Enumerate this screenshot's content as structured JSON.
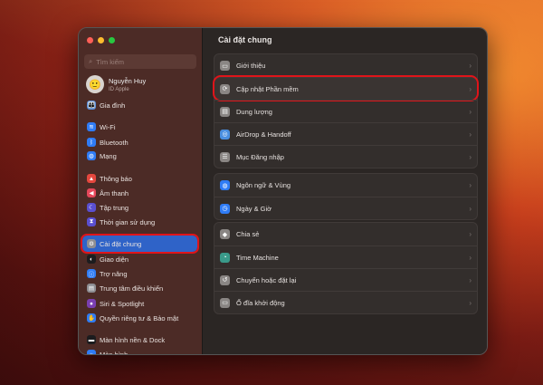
{
  "sidebar": {
    "search_placeholder": "Tìm kiếm",
    "profile": {
      "name": "Nguyễn Huy",
      "subtitle": "ID Apple"
    },
    "items": [
      {
        "label": "Gia đình",
        "icon": "family-icon",
        "color": "#5b8fd9"
      },
      {
        "label": "Wi-Fi",
        "icon": "wifi-icon",
        "color": "#2f7cf6"
      },
      {
        "label": "Bluetooth",
        "icon": "bluetooth-icon",
        "color": "#2f7cf6"
      },
      {
        "label": "Mạng",
        "icon": "globe-icon",
        "color": "#2f7cf6"
      },
      {
        "label": "Thông báo",
        "icon": "bell-icon",
        "color": "#e5473e"
      },
      {
        "label": "Âm thanh",
        "icon": "speaker-icon",
        "color": "#e5475a"
      },
      {
        "label": "Tập trung",
        "icon": "moon-icon",
        "color": "#5a4fd0"
      },
      {
        "label": "Thời gian sử dụng",
        "icon": "hourglass-icon",
        "color": "#5a4fd0"
      },
      {
        "label": "Cài đặt chung",
        "icon": "gear-icon",
        "color": "#8e8e93"
      },
      {
        "label": "Giao diện",
        "icon": "appearance-icon",
        "color": "#1c1c1e"
      },
      {
        "label": "Trợ năng",
        "icon": "accessibility-icon",
        "color": "#2f7cf6"
      },
      {
        "label": "Trung tâm điều khiển",
        "icon": "control-center-icon",
        "color": "#8e8e93"
      },
      {
        "label": "Siri & Spotlight",
        "icon": "siri-icon",
        "color": "#7a3fb0"
      },
      {
        "label": "Quyền riêng tư & Bảo mật",
        "icon": "hand-icon",
        "color": "#2f7cf6"
      },
      {
        "label": "Màn hình nền & Dock",
        "icon": "dock-icon",
        "color": "#1c1c1e"
      },
      {
        "label": "Màn hình",
        "icon": "display-icon",
        "color": "#2f7cf6"
      }
    ]
  },
  "main": {
    "title": "Cài đặt chung",
    "groups": [
      [
        {
          "label": "Giới thiệu",
          "icon": "laptop-icon"
        },
        {
          "label": "Cập nhật Phần mềm",
          "icon": "update-icon"
        },
        {
          "label": "Dung lượng",
          "icon": "storage-icon"
        },
        {
          "label": "AirDrop & Handoff",
          "icon": "airdrop-icon"
        },
        {
          "label": "Mục Đăng nhập",
          "icon": "list-icon"
        }
      ],
      [
        {
          "label": "Ngôn ngữ & Vùng",
          "icon": "globe-icon"
        },
        {
          "label": "Ngày & Giờ",
          "icon": "calendar-clock-icon"
        }
      ],
      [
        {
          "label": "Chia sẻ",
          "icon": "sharing-icon"
        },
        {
          "label": "Time Machine",
          "icon": "time-machine-icon"
        },
        {
          "label": "Chuyển hoặc đặt lại",
          "icon": "reset-icon"
        },
        {
          "label": "Ổ đĩa khởi động",
          "icon": "disk-icon"
        }
      ]
    ]
  }
}
